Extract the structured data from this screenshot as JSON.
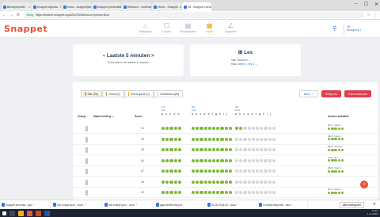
{
  "browser": {
    "tabs": [
      {
        "label": "Beroepsprofiel"
      },
      {
        "label": "Snappet Agenda - Waar"
      },
      {
        "label": "Inbox - snappet@snap"
      },
      {
        "label": "Snappet presentatie LN"
      },
      {
        "label": "Rekenen - ondersteunin"
      },
      {
        "label": "Home - Snappet - Wer"
      },
      {
        "label": "18 - Snappet Leerkracht"
      }
    ],
    "url_secure": "Veilig",
    "url": "https://teacher.snappet.org/#/5109158/lesson?period=Now"
  },
  "app": {
    "logo": "Snappet",
    "nav": [
      {
        "label": "Startpagina",
        "icon": "home-icon",
        "glyph": "⌂"
      },
      {
        "label": "Lessen",
        "icon": "lessons-icon",
        "glyph": "☐"
      },
      {
        "label": "Werkpakketten",
        "icon": "workpackages-icon",
        "glyph": "▤"
      },
      {
        "label": "Volgen",
        "icon": "follow-icon",
        "glyph": "▦"
      },
      {
        "label": "Rapporten",
        "icon": "reports-icon",
        "glyph": "∠"
      }
    ],
    "user": {
      "line1": "GR",
      "line2": "Werkgroep 1"
    }
  },
  "last_card": {
    "title": "Laatste 5 minuten >",
    "subtitle": "Toont alleen de laatste 5 minuten"
  },
  "lesson_card": {
    "title": "Les",
    "subject_label": "Vak:",
    "subject_value": "Rekenen",
    "class_label": "Klas:",
    "class_value": "Week 1, les 3"
  },
  "filters": [
    {
      "label": "Alle (26)",
      "color": "#f0a000"
    },
    {
      "label": "Goed (0)",
      "color": "#7db93a"
    },
    {
      "label": "Soms goed (0)",
      "color": "#f0a000"
    },
    {
      "label": "Onbekend (26)",
      "color": "#c5c5c5"
    }
  ],
  "actions": {
    "more": "Meer",
    "add": "Bekijk les",
    "end": "Extra instructie"
  },
  "table": {
    "col_group": "Groep",
    "col_name": "Naam leerling",
    "col_score": "Score",
    "col_activity": "Andere activiteit",
    "groups": [
      {
        "num": "1/1",
        "sub": "1/9",
        "letters": "a b c d e"
      },
      {
        "num": "2/2",
        "sub": "1/13",
        "letters": "a b c d e f g h i j"
      },
      {
        "num": "3/3",
        "sub": "1/13",
        "letters": "a b c d e f g h i j"
      }
    ],
    "rows": [
      {
        "score": "91",
        "g1": 5,
        "g2": 10,
        "g3": 2,
        "activity": "Wk 8 - Opsch",
        "act_dots": 5
      },
      {
        "score": "90",
        "g1": 5,
        "g2": 10,
        "g3": 0,
        "activity": "Wk 8 - Opsch",
        "act_dots": 5
      },
      {
        "score": "96",
        "g1": 5,
        "g2": 10,
        "g3": 0,
        "activity": "Wk 8 - Woorde",
        "act_dots": 5
      },
      {
        "score": "84",
        "g1": 5,
        "g2": 10,
        "g3": 0,
        "activity": "Taal - wk 1",
        "act_dots": 5
      },
      {
        "score": "87",
        "g1": 5,
        "g2": 10,
        "g3": 0,
        "activity": "Wk 8 - Opsch",
        "act_dots": 5
      },
      {
        "score": "95",
        "g1": 5,
        "g2": 10,
        "g3": 0,
        "activity": "",
        "act_dots": 0
      },
      {
        "score": "92",
        "g1": 5,
        "g2": 10,
        "g3": 0,
        "activity": "Wk 8 - Opsch",
        "act_dots": 5
      }
    ]
  },
  "downloads": [
    {
      "label": "Snappet presenta...pptx"
    },
    {
      "label": "Info boekje groe....docx"
    },
    {
      "label": "Info boekje groe....docx"
    },
    {
      "label": "jaardoel/Rumba.pdf"
    },
    {
      "label": "00-00-2018-00....docx"
    },
    {
      "label": "Competentieprofie...docx"
    }
  ],
  "download_all": "Alles weergeven",
  "tray": {
    "time": "14:13",
    "date": "1-11-2018"
  },
  "colors": {
    "accent": "#e8502f",
    "active_nav": "#f0a000",
    "good": "#7db93a",
    "link": "#2a6fbf"
  }
}
